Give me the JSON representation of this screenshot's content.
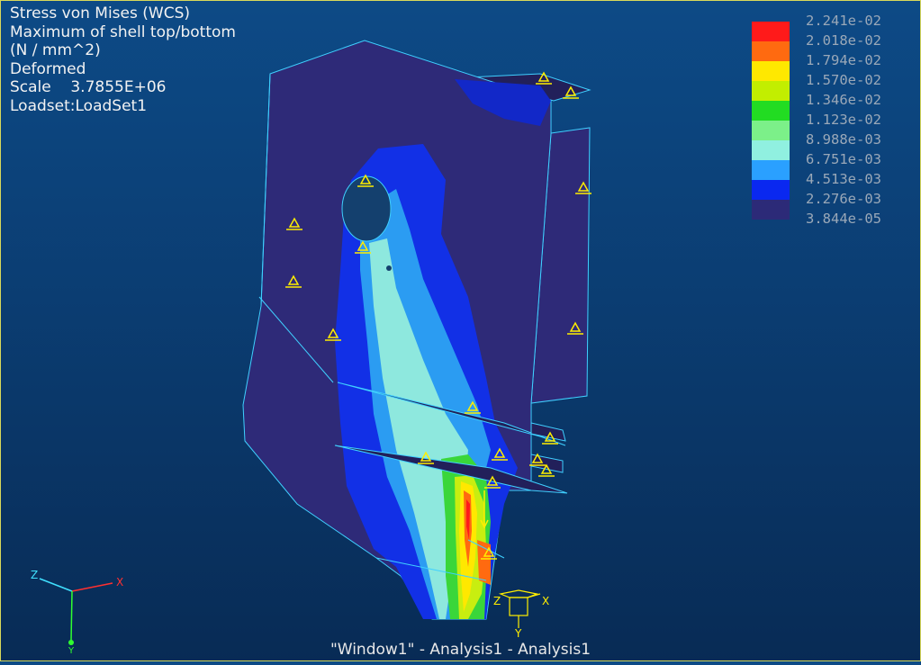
{
  "header": {
    "lines": [
      "Stress von Mises (WCS)",
      "Maximum of shell top/bottom",
      "(N / mm^2)",
      "Deformed",
      "Scale    3.7855E+06",
      "Loadset:LoadSet1"
    ]
  },
  "legend": {
    "values": [
      "2.241e-02",
      "2.018e-02",
      "1.794e-02",
      "1.570e-02",
      "1.346e-02",
      "1.123e-02",
      "8.988e-03",
      "6.751e-03",
      "4.513e-03",
      "2.276e-03",
      "3.844e-05"
    ],
    "colors": [
      "#ff1a1a",
      "#ff6a10",
      "#ffe800",
      "#c2ee00",
      "#22dc22",
      "#7cf089",
      "#90f0e0",
      "#2aa0ff",
      "#0a28f0",
      "#2c2a78"
    ]
  },
  "triad": {
    "x": "X",
    "y": "Y",
    "z": "Z"
  },
  "csys": {
    "x": "X",
    "y": "Y",
    "z": "Z"
  },
  "footer": {
    "text": "\"Window1\" - Analysis1 - Analysis1"
  }
}
